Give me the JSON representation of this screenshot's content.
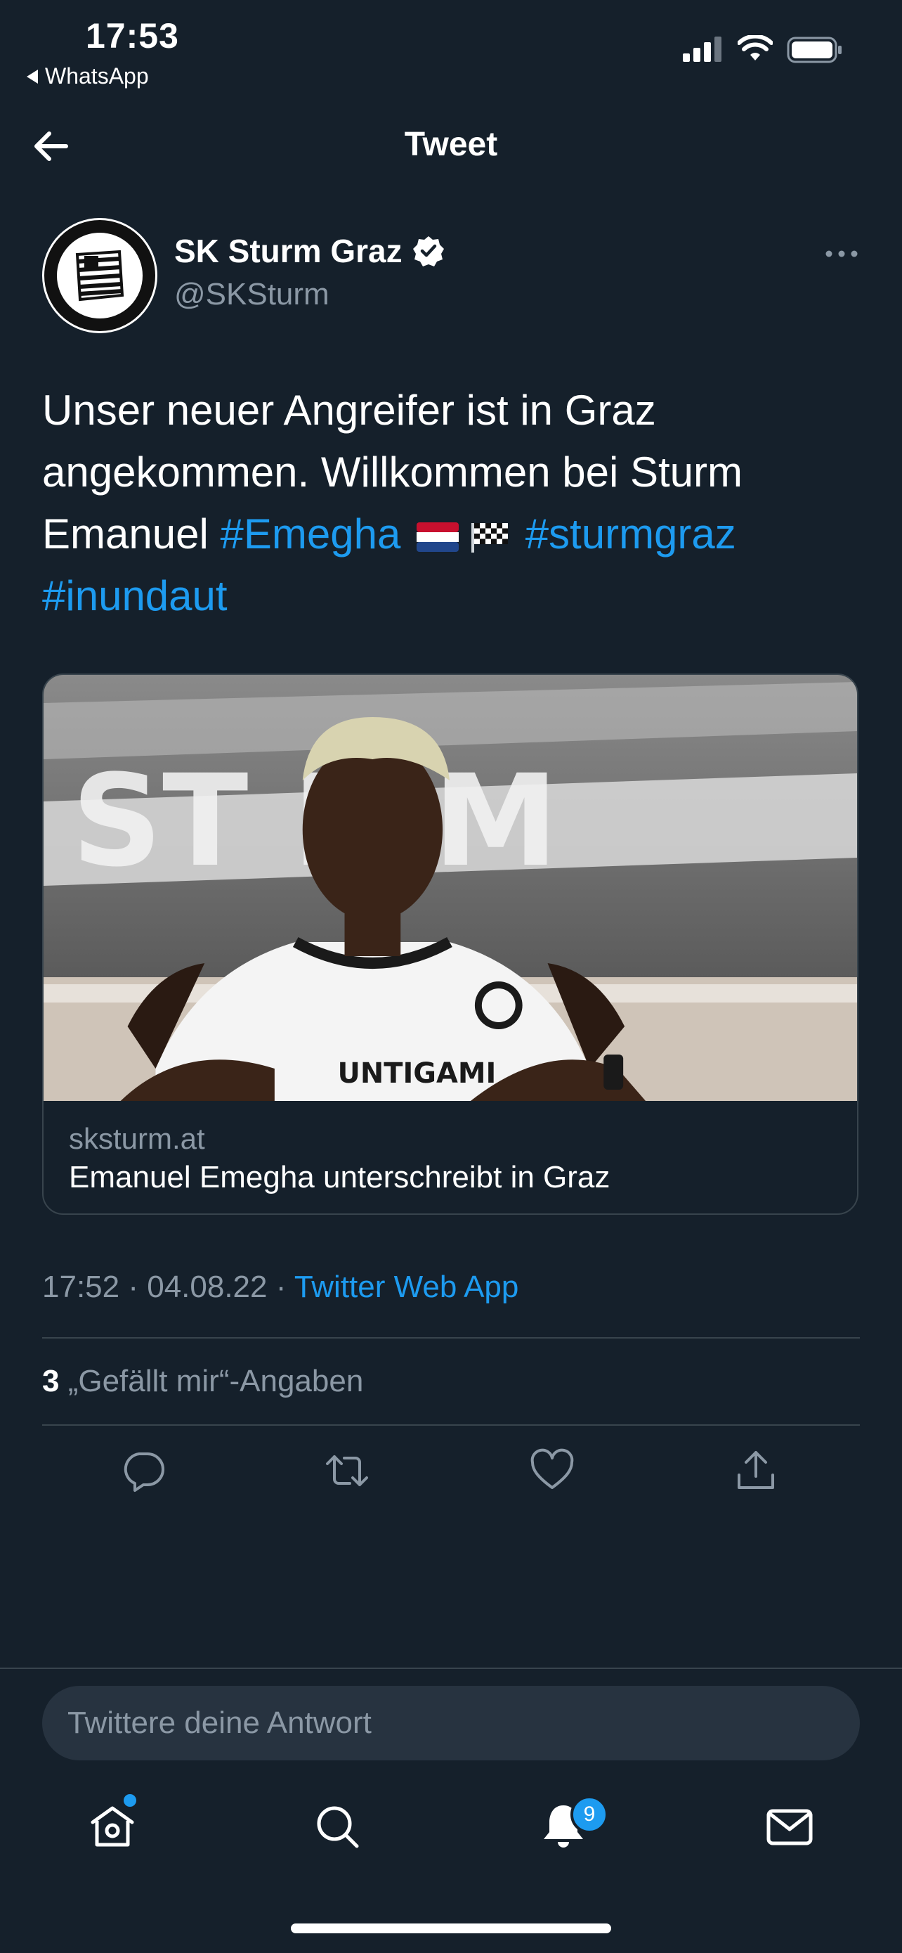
{
  "status_bar": {
    "time": "17:53",
    "back_app": "WhatsApp"
  },
  "header": {
    "title": "Tweet"
  },
  "author": {
    "name": "SK Sturm Graz",
    "handle": "@SKSturm"
  },
  "tweet": {
    "text_part1": "Unser neuer Angreifer ist in Graz angekommen. Willkommen bei Sturm Emanuel ",
    "hashtag1": "#Emegha",
    "hashtag2": "#sturmgraz",
    "hashtag3": "#inundaut"
  },
  "card": {
    "domain": "sksturm.at",
    "title": "Emanuel Emegha unterschreibt in Graz"
  },
  "meta": {
    "time": "17:52",
    "sep": " · ",
    "date": "04.08.22",
    "source": "Twitter Web App"
  },
  "likes": {
    "count": "3",
    "label": " „Gefällt mir“-Angaben"
  },
  "reply": {
    "placeholder": "Twittere deine Antwort"
  },
  "tabbar": {
    "notifications_badge": "9"
  },
  "colors": {
    "background": "#15202b",
    "accent": "#1d9bf0",
    "muted": "#8b98a5",
    "divider": "#38444d"
  },
  "icons": [
    "back-arrow-icon",
    "verified-icon",
    "more-icon",
    "reply-icon",
    "retweet-icon",
    "like-icon",
    "share-icon",
    "home-icon",
    "search-icon",
    "notifications-icon",
    "messages-icon"
  ]
}
